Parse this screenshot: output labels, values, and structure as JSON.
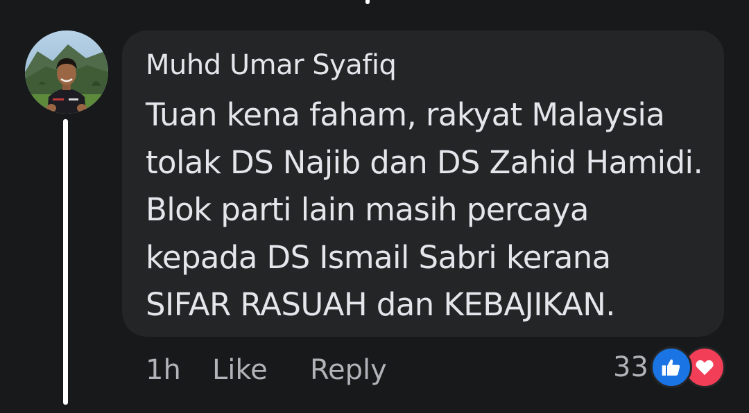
{
  "comment": {
    "author": "Muhd Umar Syafiq",
    "text_lines": [
      "Tuan kena faham, rakyat Malaysia",
      "tolak DS Najib dan DS Zahid Hamidi.",
      "Blok parti lain masih percaya",
      "kepada DS Ismail Sabri kerana",
      "SIFAR RASUAH dan KEBAJIKAN."
    ],
    "timestamp": "1h",
    "like_label": "Like",
    "reply_label": "Reply",
    "reaction_count": "33",
    "reaction_icons": [
      "like-icon",
      "love-icon"
    ]
  },
  "colors": {
    "background": "#18191a",
    "bubble": "#242526",
    "text": "#e4e6eb",
    "secondary_text": "#b0b3b8",
    "like_blue": "#1b74e4",
    "love_red": "#f33e58"
  }
}
